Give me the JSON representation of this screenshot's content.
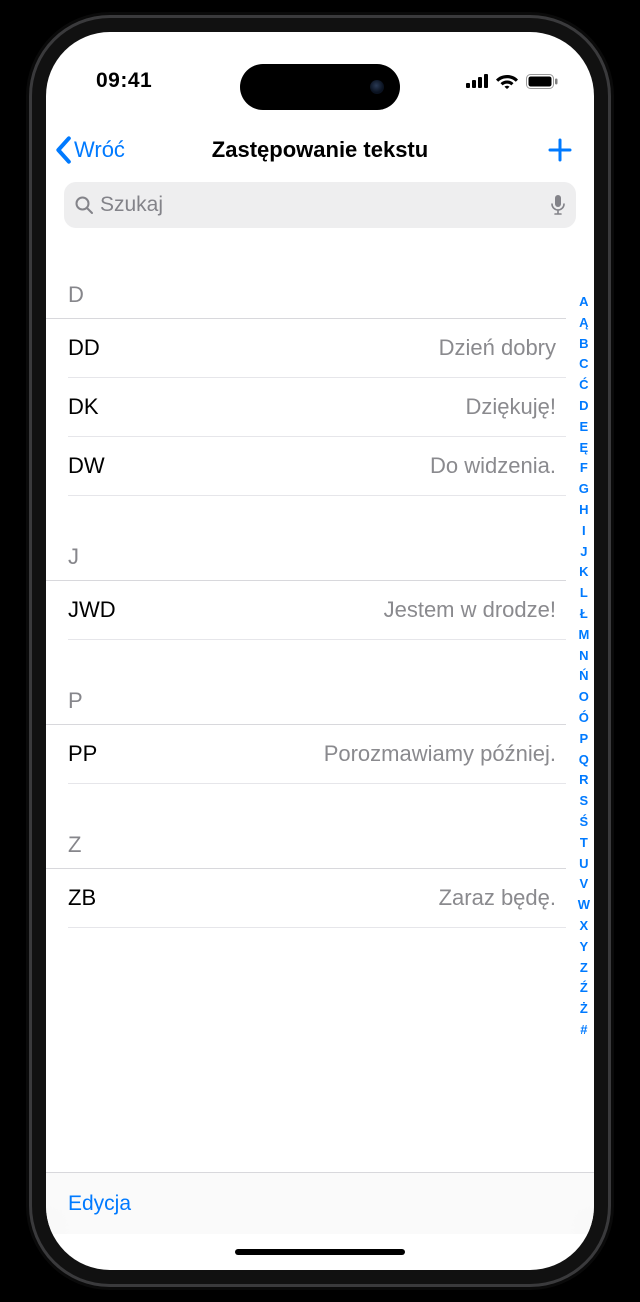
{
  "status": {
    "time": "09:41"
  },
  "nav": {
    "back_label": "Wróć",
    "title": "Zastępowanie tekstu"
  },
  "search": {
    "placeholder": "Szukaj"
  },
  "sections": {
    "d": {
      "header": "D",
      "items": [
        {
          "shortcut": "DD",
          "phrase": "Dzień dobry"
        },
        {
          "shortcut": "DK",
          "phrase": "Dziękuję!"
        },
        {
          "shortcut": "DW",
          "phrase": "Do widzenia."
        }
      ]
    },
    "j": {
      "header": "J",
      "items": [
        {
          "shortcut": "JWD",
          "phrase": "Jestem w drodze!"
        }
      ]
    },
    "p": {
      "header": "P",
      "items": [
        {
          "shortcut": "PP",
          "phrase": "Porozmawiamy później."
        }
      ]
    },
    "z": {
      "header": "Z",
      "items": [
        {
          "shortcut": "ZB",
          "phrase": "Zaraz będę."
        }
      ]
    }
  },
  "index_letters": [
    "A",
    "Ą",
    "B",
    "C",
    "Ć",
    "D",
    "E",
    "Ę",
    "F",
    "G",
    "H",
    "I",
    "J",
    "K",
    "L",
    "Ł",
    "M",
    "N",
    "Ń",
    "O",
    "Ó",
    "P",
    "Q",
    "R",
    "S",
    "Ś",
    "T",
    "U",
    "V",
    "W",
    "X",
    "Y",
    "Z",
    "Ź",
    "Ż",
    "#"
  ],
  "toolbar": {
    "edit_label": "Edycja"
  }
}
